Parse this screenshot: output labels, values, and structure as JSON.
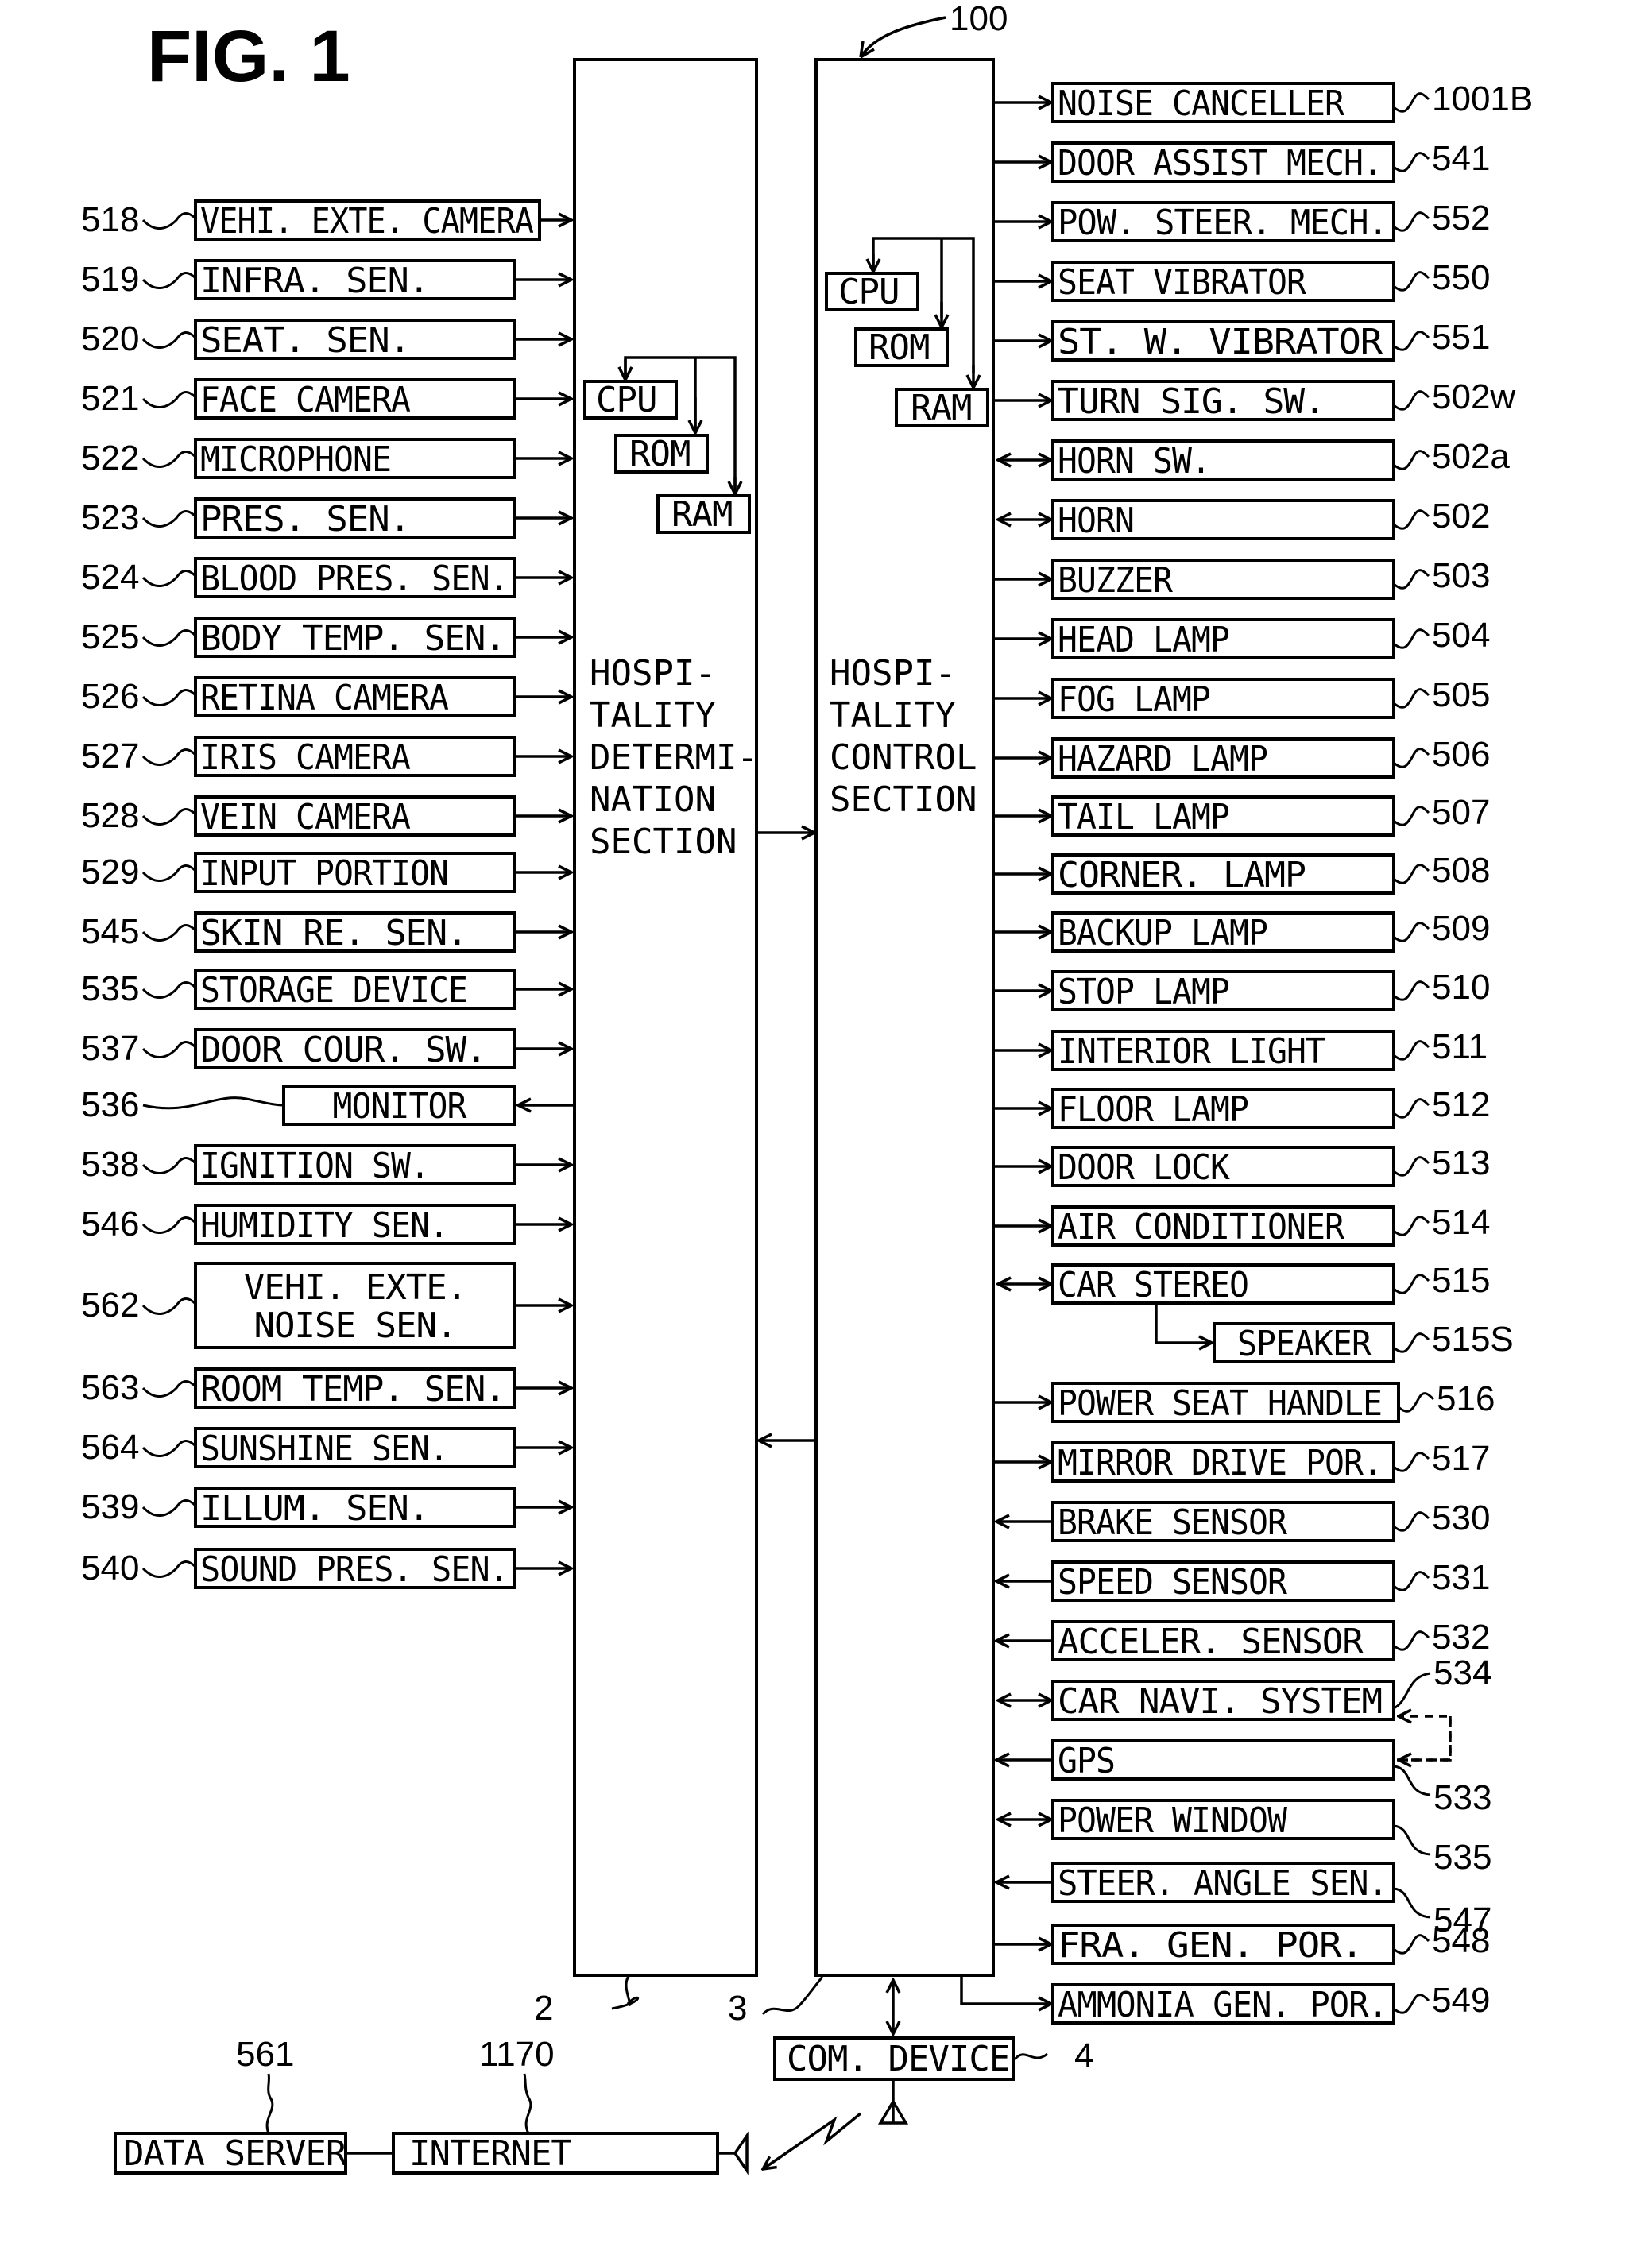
{
  "figure": {
    "title": "FIG. 1",
    "system_ref": "100",
    "determination_section": {
      "ref": "2",
      "lines": [
        "HOSPI-",
        "TALITY",
        "DETERMI-",
        "NATION",
        "SECTION"
      ],
      "cpu": "CPU",
      "rom": "ROM",
      "ram": "RAM"
    },
    "control_section": {
      "ref": "3",
      "lines": [
        "HOSPI-",
        "TALITY",
        "CONTROL",
        "SECTION"
      ],
      "cpu": "CPU",
      "rom": "ROM",
      "ram": "RAM"
    },
    "com_device": {
      "label": "COM. DEVICE",
      "ref": "4"
    },
    "internet": {
      "label": "INTERNET",
      "ref": "1170"
    },
    "data_server": {
      "label": "DATA SERVER",
      "ref": "561"
    }
  },
  "left_devices": [
    {
      "ref": "518",
      "label": "VEHI. EXTE. CAMERA",
      "dir": "in"
    },
    {
      "ref": "519",
      "label": "INFRA.  SEN.",
      "dir": "in"
    },
    {
      "ref": "520",
      "label": "SEAT.  SEN.",
      "dir": "in"
    },
    {
      "ref": "521",
      "label": "FACE CAMERA",
      "dir": "in"
    },
    {
      "ref": "522",
      "label": "MICROPHONE",
      "dir": "in"
    },
    {
      "ref": "523",
      "label": "PRES.  SEN.",
      "dir": "in"
    },
    {
      "ref": "524",
      "label": "BLOOD PRES.  SEN.",
      "dir": "in"
    },
    {
      "ref": "525",
      "label": "BODY TEMP.  SEN.",
      "dir": "in"
    },
    {
      "ref": "526",
      "label": "RETINA CAMERA",
      "dir": "in"
    },
    {
      "ref": "527",
      "label": "IRIS CAMERA",
      "dir": "in"
    },
    {
      "ref": "528",
      "label": "VEIN CAMERA",
      "dir": "in"
    },
    {
      "ref": "529",
      "label": "INPUT PORTION",
      "dir": "in"
    },
    {
      "ref": "545",
      "label": "SKIN RE.  SEN.",
      "dir": "in"
    },
    {
      "ref": "535",
      "label": "STORAGE DEVICE",
      "dir": "in"
    },
    {
      "ref": "537",
      "label": "DOOR COUR.  SW.",
      "dir": "in"
    },
    {
      "ref": "536",
      "label": "MONITOR",
      "dir": "out"
    },
    {
      "ref": "538",
      "label": "IGNITION SW.",
      "dir": "in"
    },
    {
      "ref": "546",
      "label": "HUMIDITY SEN.",
      "dir": "in"
    },
    {
      "ref": "562",
      "label": "VEHI.  EXTE.",
      "label2": "NOISE SEN.",
      "dir": "in"
    },
    {
      "ref": "563",
      "label": "ROOM TEMP.  SEN.",
      "dir": "in"
    },
    {
      "ref": "564",
      "label": "SUNSHINE SEN.",
      "dir": "in"
    },
    {
      "ref": "539",
      "label": "ILLUM.  SEN.",
      "dir": "in"
    },
    {
      "ref": "540",
      "label": "SOUND PRES.  SEN.",
      "dir": "in"
    }
  ],
  "right_devices": [
    {
      "ref": "1001B",
      "label": "NOISE CANCELLER",
      "dir": "out"
    },
    {
      "ref": "541",
      "label": "DOOR ASSIST MECH.",
      "dir": "out"
    },
    {
      "ref": "552",
      "label": "POW.  STEER.  MECH.",
      "dir": "out"
    },
    {
      "ref": "550",
      "label": "SEAT VIBRATOR",
      "dir": "out"
    },
    {
      "ref": "551",
      "label": "ST.  W.  VIBRATOR",
      "dir": "out"
    },
    {
      "ref": "502w",
      "label": "TURN SIG.  SW.",
      "dir": "out"
    },
    {
      "ref": "502a",
      "label": "HORN SW.",
      "dir": "both"
    },
    {
      "ref": "502",
      "label": "HORN",
      "dir": "both"
    },
    {
      "ref": "503",
      "label": "BUZZER",
      "dir": "out"
    },
    {
      "ref": "504",
      "label": "HEAD LAMP",
      "dir": "out"
    },
    {
      "ref": "505",
      "label": "FOG LAMP",
      "dir": "out"
    },
    {
      "ref": "506",
      "label": "HAZARD LAMP",
      "dir": "out"
    },
    {
      "ref": "507",
      "label": "TAIL LAMP",
      "dir": "out"
    },
    {
      "ref": "508",
      "label": "CORNER.  LAMP",
      "dir": "out"
    },
    {
      "ref": "509",
      "label": "BACKUP LAMP",
      "dir": "out"
    },
    {
      "ref": "510",
      "label": "STOP LAMP",
      "dir": "out"
    },
    {
      "ref": "511",
      "label": "INTERIOR LIGHT",
      "dir": "out"
    },
    {
      "ref": "512",
      "label": "FLOOR LAMP",
      "dir": "out"
    },
    {
      "ref": "513",
      "label": "DOOR LOCK",
      "dir": "out"
    },
    {
      "ref": "514",
      "label": "AIR CONDITIONER",
      "dir": "out"
    },
    {
      "ref": "515",
      "label": "CAR STEREO",
      "dir": "both"
    },
    {
      "ref": "515S",
      "label": "SPEAKER",
      "dir": "sub"
    },
    {
      "ref": "516",
      "label": "POWER SEAT HANDLE",
      "dir": "out"
    },
    {
      "ref": "517",
      "label": "MIRROR DRIVE POR.",
      "dir": "out"
    },
    {
      "ref": "530",
      "label": "BRAKE SENSOR",
      "dir": "in"
    },
    {
      "ref": "531",
      "label": "SPEED SENSOR",
      "dir": "in"
    },
    {
      "ref": "532",
      "label": "ACCELER.  SENSOR",
      "dir": "in"
    },
    {
      "ref": "534",
      "label": "CAR NAVI.  SYSTEM",
      "dir": "both"
    },
    {
      "ref": "533",
      "label": "GPS",
      "dir": "in"
    },
    {
      "ref": "535",
      "label": "POWER WINDOW",
      "dir": "both"
    },
    {
      "ref": "547",
      "label": "STEER.  ANGLE SEN.",
      "dir": "in"
    },
    {
      "ref": "548",
      "label": "FRA.  GEN.  POR.",
      "dir": "out"
    },
    {
      "ref": "549",
      "label": "AMMONIA GEN.  POR.",
      "dir": "out"
    }
  ]
}
